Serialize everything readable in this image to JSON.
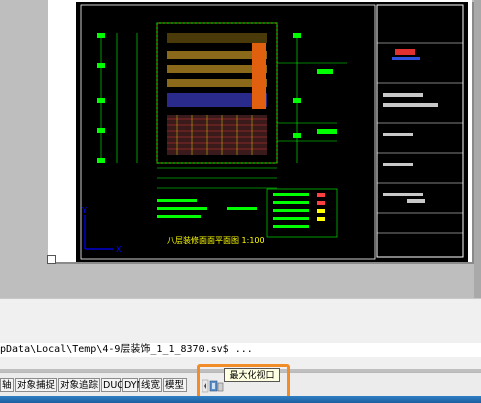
{
  "drawing": {
    "plan_title": "八层装修面面平面图 1:100",
    "y_axis_label": "Y",
    "x_axis_label": "X"
  },
  "command_line": {
    "text": "pData\\Local\\Temp\\4-9层装饰_1_1_8370.sv$ ..."
  },
  "status_bar": {
    "buttons": [
      "轴",
      "对象捕捉",
      "对象追踪",
      "DUCS",
      "DYN",
      "线宽",
      "模型"
    ]
  },
  "tooltip": {
    "text": "最大化视口"
  },
  "colors": {
    "canvas_bg": "#bebebe",
    "viewport_bg": "#000000",
    "highlight": "#f28c28",
    "tooltip_bg": "#ffffe1"
  }
}
